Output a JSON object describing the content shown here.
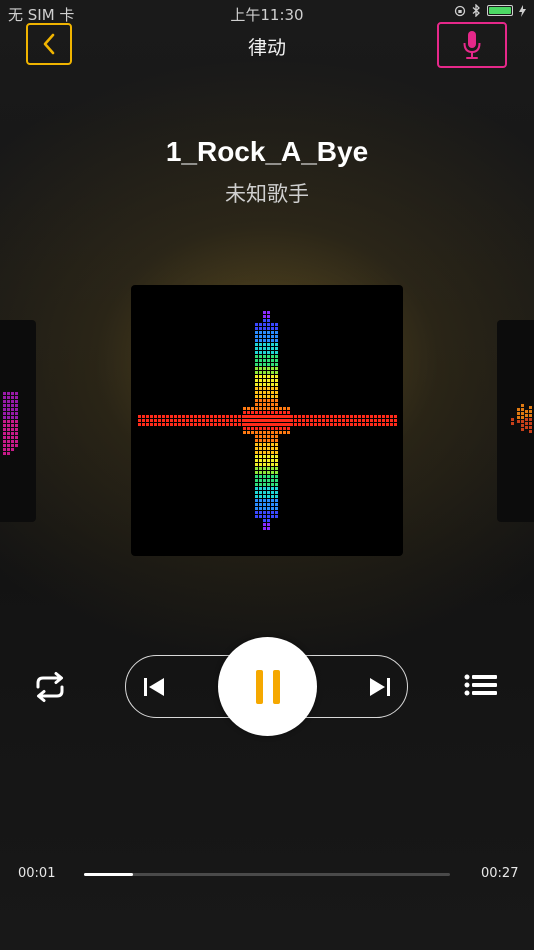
{
  "status_bar": {
    "carrier": "无 SIM 卡",
    "time": "上午11:30",
    "battery_color": "#4cd964"
  },
  "nav": {
    "title": "律动",
    "back_icon": "chevron-left-icon",
    "mic_icon": "microphone-icon",
    "back_border_color": "#f0b400",
    "mic_border_color": "#e6288a"
  },
  "song": {
    "title": "1_Rock_A_Bye",
    "artist": "未知歌手"
  },
  "controls": {
    "repeat_icon": "repeat-icon",
    "prev_icon": "skip-previous-icon",
    "play_pause_icon": "pause-icon",
    "next_icon": "skip-next-icon",
    "playlist_icon": "playlist-icon",
    "accent_color": "#f5a800"
  },
  "progress": {
    "current": "00:01",
    "total": "00:27",
    "fraction": 0.135
  }
}
